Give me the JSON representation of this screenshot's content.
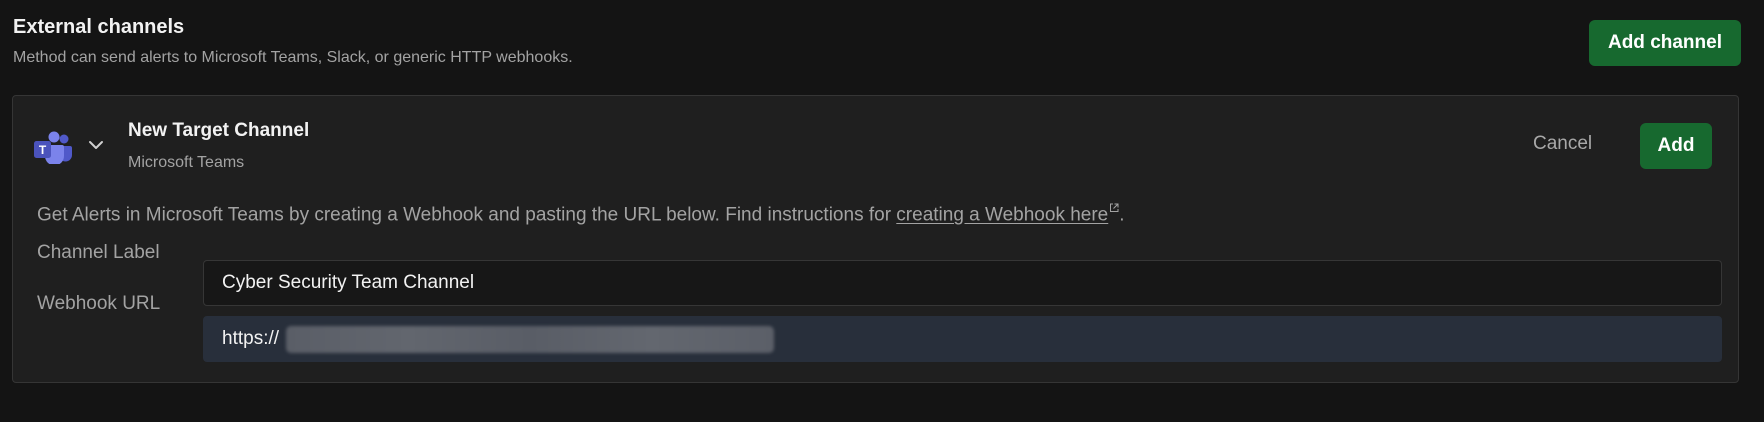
{
  "header": {
    "title": "External channels",
    "subtitle": "Method can send alerts to Microsoft Teams, Slack, or generic HTTP webhooks.",
    "add_channel_label": "Add channel"
  },
  "channel": {
    "icon": "microsoft-teams-icon",
    "title": "New Target Channel",
    "type": "Microsoft Teams",
    "cancel_label": "Cancel",
    "add_label": "Add",
    "description_prefix": "Get Alerts in Microsoft Teams by creating a Webhook and pasting the URL below. Find instructions for ",
    "description_link": "creating a Webhook here",
    "description_suffix": ".",
    "fields": {
      "label": {
        "name": "Channel Label",
        "value": "Cyber Security Team Channel"
      },
      "webhook": {
        "name": "Webhook URL",
        "value": "https://"
      }
    }
  },
  "colors": {
    "background": "#141414",
    "card": "#1f1f1f",
    "primary_button": "#17692f",
    "muted_text": "#a3a3a3",
    "webhook_field": "#282f3b",
    "teams_purple": "#5059c9"
  }
}
